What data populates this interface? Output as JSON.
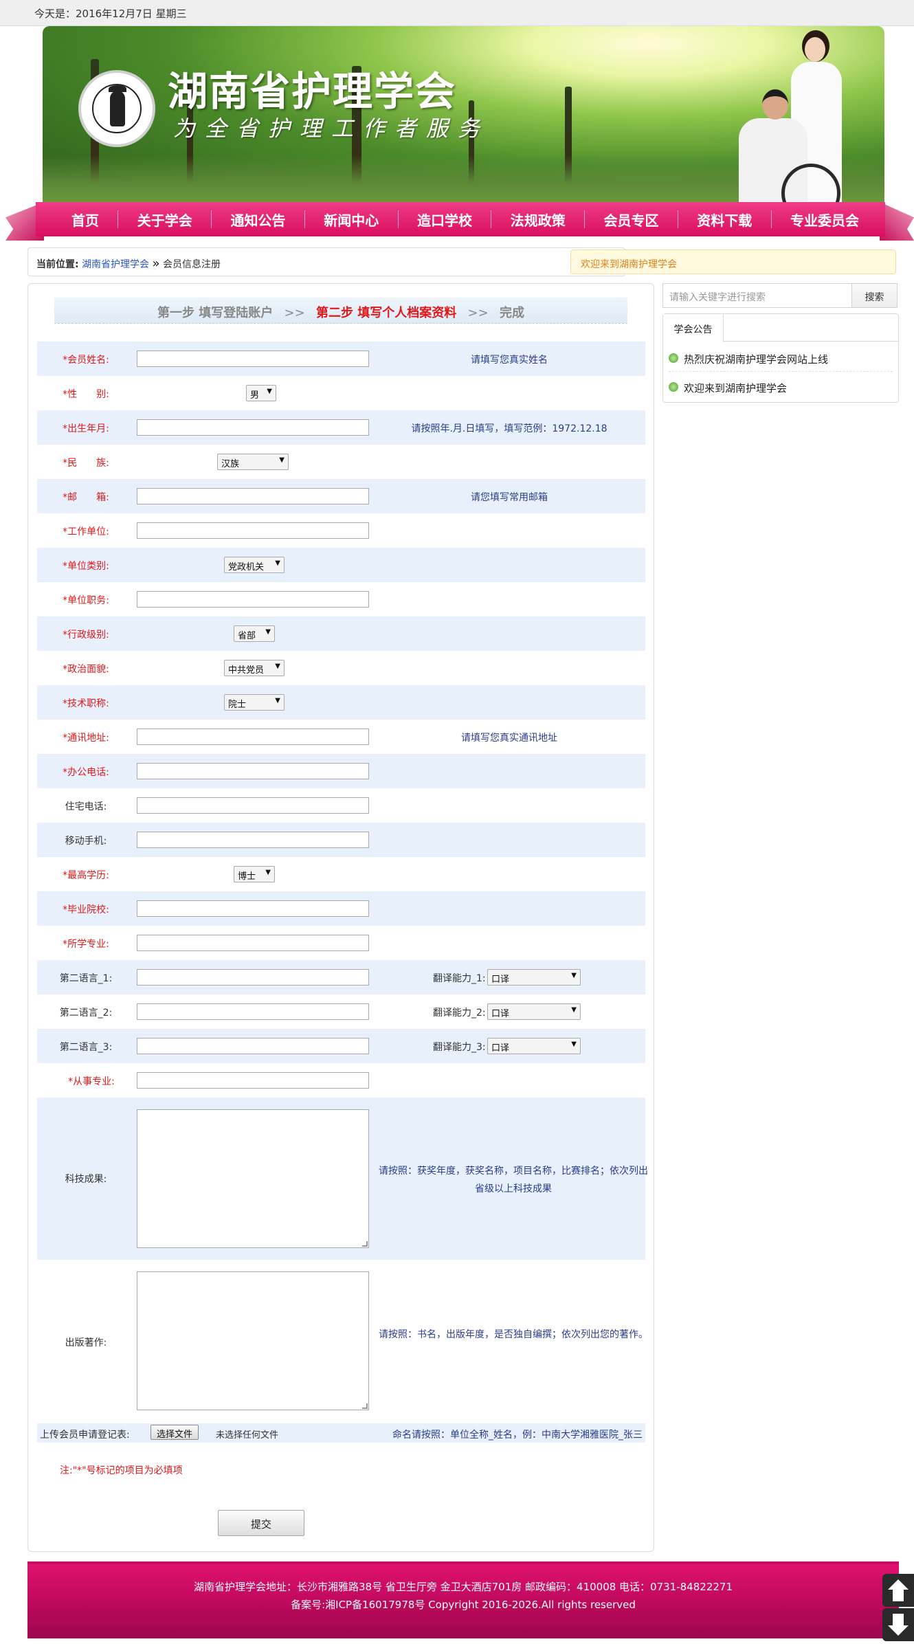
{
  "topbar": {
    "date": "今天是：2016年12月7日 星期三"
  },
  "banner": {
    "title": "湖南省护理学会",
    "slogan": "为全省护理工作者服务"
  },
  "nav": [
    "首页",
    "关于学会",
    "通知公告",
    "新闻中心",
    "造口学校",
    "法规政策",
    "会员专区",
    "资料下载",
    "专业委员会"
  ],
  "breadcrumb": {
    "label": "当前位置:",
    "home": "湖南省护理学会",
    "separator": "»",
    "current": "会员信息注册"
  },
  "welcome": "欢迎来到湖南护理学会",
  "steps": {
    "step1": "第一步 填写登陆账户",
    "step2": "第二步 填写个人档案资料",
    "step3": "完成",
    "arrow": ">>"
  },
  "form": {
    "name_label": "*会员姓名:",
    "name_hint": "请填写您真实姓名",
    "gender_label": "*性　　别:",
    "gender_value": "男",
    "birth_label": "*出生年月:",
    "birth_hint": "请按照年.月.日填写，填写范例：1972.12.18",
    "ethnic_label": "*民　　族:",
    "ethnic_value": "汉族",
    "email_label": "*邮　　箱:",
    "email_hint": "请您填写常用邮箱",
    "work_label": "*工作单位:",
    "unit_type_label": "*单位类别:",
    "unit_type_value": "党政机关",
    "position_label": "*单位职务:",
    "admin_label": "*行政级别:",
    "admin_value": "省部",
    "political_label": "*政治面貌:",
    "political_value": "中共党员",
    "title_label": "*技术职称:",
    "title_value": "院士",
    "address_label": "*通讯地址:",
    "address_hint": "请填写您真实通讯地址",
    "office_label": "*办公电话:",
    "home_label": "住宅电话:",
    "mobile_label": "移动手机:",
    "edu_label": "*最高学历:",
    "edu_value": "博士",
    "school_label": "*毕业院校:",
    "major_label": "*所学专业:",
    "lang1_label": "第二语言_1:",
    "trans1_label": "翻译能力_1:",
    "trans1_value": "口译",
    "lang2_label": "第二语言_2:",
    "trans2_label": "翻译能力_2:",
    "trans2_value": "口译",
    "lang3_label": "第二语言_3:",
    "trans3_label": "翻译能力_3:",
    "trans3_value": "口译",
    "field_label": "*从事专业:",
    "research_label": "科技成果:",
    "research_hint": "请按照：获奖年度，获奖名称，项目名称，比赛排名；依次列出省级以上科技成果",
    "publish_label": "出版著作:",
    "publish_hint": "请按照：书名，出版年度，是否独自编撰；依次列出您的著作。",
    "upload_label": "上传会员申请登记表:",
    "upload_button": "选择文件",
    "upload_nofile": "未选择任何文件",
    "upload_rule": "命名请按照：单位全称_姓名，例：中南大学湘雅医院_张三",
    "note": "注:\"*\"号标记的项目为必填项",
    "submit": "提交"
  },
  "sidebar": {
    "search_placeholder": "请输入关键字进行搜索",
    "search_button": "搜索",
    "notice_tab": "学会公告",
    "notices": [
      "热烈庆祝湖南护理学会网站上线",
      "欢迎来到湖南护理学会"
    ]
  },
  "footer": {
    "line1": "湖南省护理学会地址：长沙市湘雅路38号 省卫生厅旁 金卫大酒店701房 邮政编码：410008 电话：0731-84822271",
    "line2": "备案号:湘ICP备16017978号 Copyright 2016-2026.All rights reserved"
  },
  "colors": {
    "nav": "#d80f5f",
    "required": "#e01818",
    "hint": "#2a3c8c",
    "row_shade": "#e8f0fc",
    "footer": "#b8085a"
  }
}
